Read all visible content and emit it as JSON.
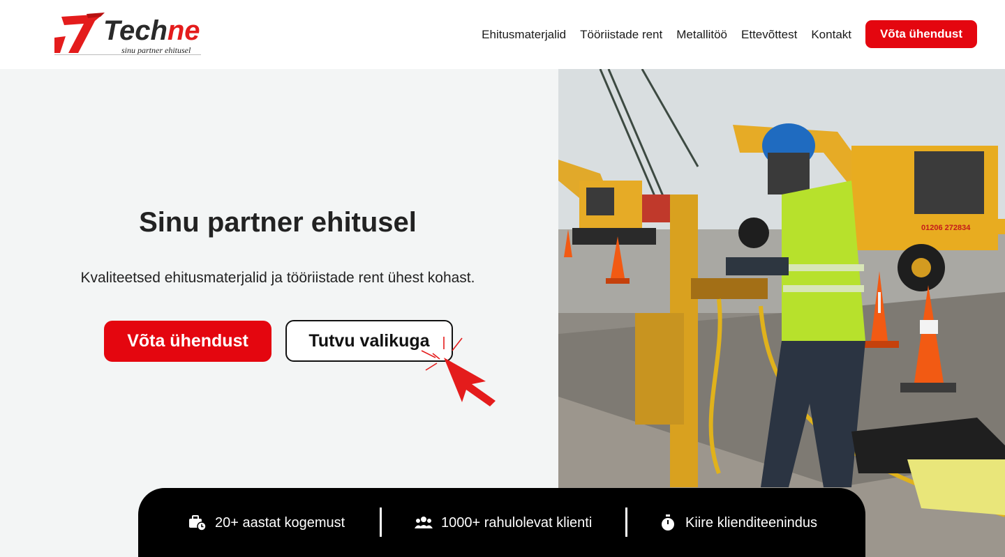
{
  "brand": {
    "name_part1": "Tech",
    "name_part2": "ne",
    "tagline": "sinu partner ehitusel",
    "accent_color": "#e4060f",
    "logo_icon": "seven-mark-icon"
  },
  "nav": {
    "items": [
      {
        "label": "Ehitusmaterjalid"
      },
      {
        "label": "Tööriistade rent"
      },
      {
        "label": "Metallitöö"
      },
      {
        "label": "Ettevõttest"
      },
      {
        "label": "Kontakt"
      }
    ],
    "cta_label": "Võta ühendust"
  },
  "hero": {
    "title": "Sinu partner ehitusel",
    "subtitle": "Kvaliteetsed ehitusmaterjalid ja tööriistade rent ühest kohast.",
    "primary_button": "Võta ühendust",
    "secondary_button": "Tutvu valikuga",
    "image_subject": "construction worker drilling with excavators and traffic cones",
    "excavator_number": "01206 272834"
  },
  "stats": {
    "items": [
      {
        "icon": "briefcase-clock-icon",
        "label": "20+ aastat kogemust"
      },
      {
        "icon": "users-icon",
        "label": "1000+ rahulolevat klienti"
      },
      {
        "icon": "stopwatch-icon",
        "label": "Kiire klienditeenindus"
      }
    ]
  }
}
